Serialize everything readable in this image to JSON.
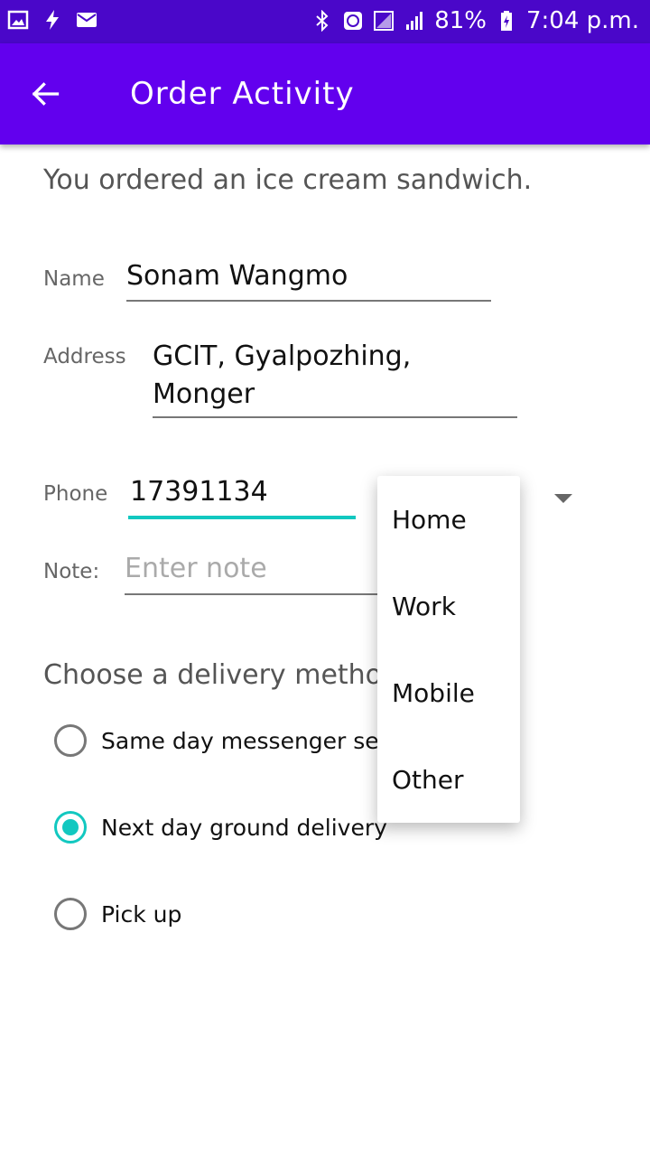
{
  "status_bar": {
    "battery": "81%",
    "time": "7:04 p.m."
  },
  "app_bar": {
    "title": "Order Activity"
  },
  "order": {
    "message": "You ordered an ice cream sandwich."
  },
  "form": {
    "name_label": "Name",
    "name_value": "Sonam Wangmo",
    "address_label": "Address",
    "address_line1": "GCIT, Gyalpozhing,",
    "address_line2": "Monger",
    "phone_label": "Phone",
    "phone_value": "17391134",
    "note_label": "Note:",
    "note_placeholder": "Enter note"
  },
  "delivery": {
    "title": "Choose a delivery method:",
    "options": [
      {
        "label": "Same day messenger service",
        "selected": false
      },
      {
        "label": "Next day ground delivery",
        "selected": true
      },
      {
        "label": "Pick up",
        "selected": false
      }
    ]
  },
  "phone_type_dropdown": {
    "options": [
      "Home",
      "Work",
      "Mobile",
      "Other"
    ]
  },
  "colors": {
    "status_bar": "#4a07c9",
    "app_bar": "#6200ee",
    "accent": "#12c8c0"
  }
}
